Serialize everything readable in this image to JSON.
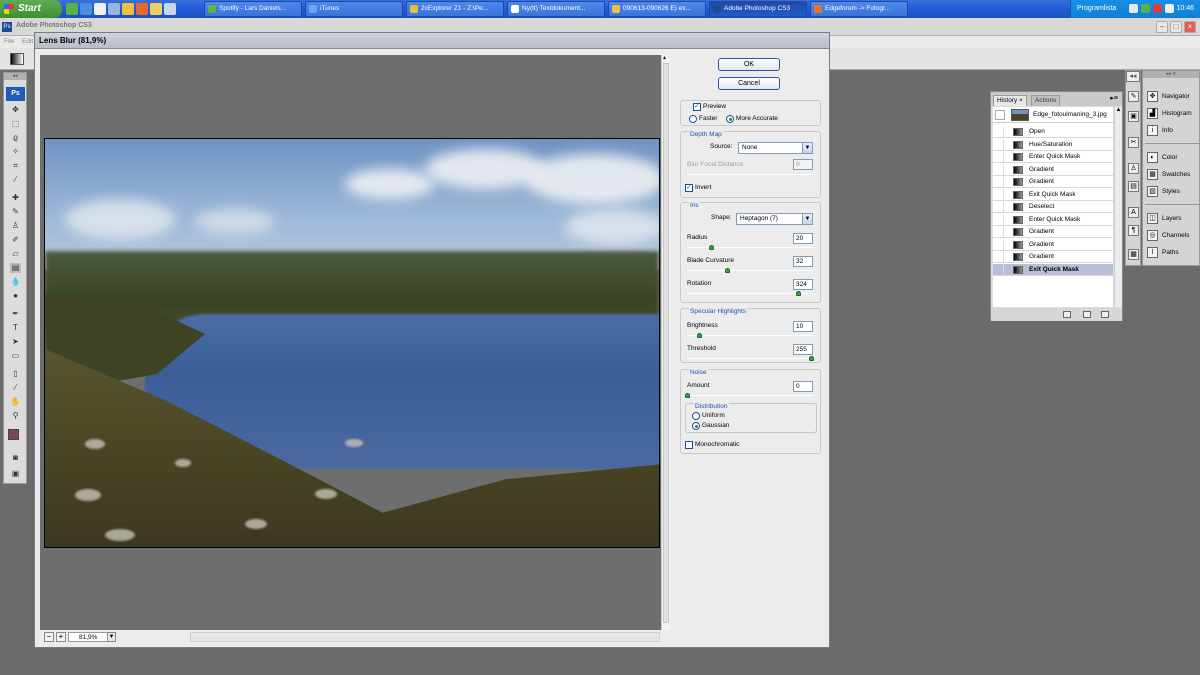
{
  "taskbar": {
    "start_label": "Start",
    "tasks": [
      {
        "label": "Spotify - Lars Daniels...",
        "color": "#5fb83c"
      },
      {
        "label": "iTunes",
        "color": "#6aa7e8"
      },
      {
        "label": "2xExplorer Z1 - Z:\\Pe...",
        "color": "#e0c040"
      },
      {
        "label": "Ny(tt) Textdokument...",
        "color": "#ffffff"
      },
      {
        "label": "090613-090626 E) ex...",
        "color": "#f0c040"
      },
      {
        "label": "Adobe Photoshop CS3",
        "color": "#1f4d93"
      },
      {
        "label": "Edgeforum -> Fotogr...",
        "color": "#e8732c"
      }
    ],
    "user": "Programlista",
    "clock": "10:46"
  },
  "photoshop": {
    "title": "Adobe Photoshop CS3",
    "logo": "Ps",
    "menu": [
      "File",
      "Edit"
    ]
  },
  "dialog": {
    "title": "Lens Blur (81,9%)",
    "ok_label": "OK",
    "cancel_label": "Cancel",
    "preview": {
      "label": "Preview",
      "checked": true
    },
    "faster_label": "Faster",
    "more_accurate_label": "More Accurate",
    "depth_map": {
      "group_label": "Depth Map",
      "source_label": "Source:",
      "source_value": "None",
      "blur_focal_label": "Blur Focal Distance",
      "blur_focal_value": "0",
      "invert_label": "Invert"
    },
    "iris": {
      "group_label": "Iris",
      "shape_label": "Shape:",
      "shape_value": "Heptagon (7)",
      "radius_label": "Radius",
      "radius_value": "20",
      "blade_label": "Blade Curvature",
      "blade_value": "32",
      "rotation_label": "Rotation",
      "rotation_value": "324"
    },
    "specular": {
      "group_label": "Specular Highlights",
      "brightness_label": "Brightness",
      "brightness_value": "10",
      "threshold_label": "Threshold",
      "threshold_value": "255"
    },
    "noise": {
      "group_label": "Noise",
      "amount_label": "Amount",
      "amount_value": "0",
      "distribution_label": "Distribution",
      "uniform_label": "Uniform",
      "gaussian_label": "Gaussian",
      "mono_label": "Monochromatic"
    },
    "zoom_value": "81,9%"
  },
  "history": {
    "tab_history": "History",
    "tab_actions": "Actions",
    "snapshot": "Edge_fotoulmaning_3.jpg",
    "steps": [
      "Open",
      "Hue/Saturation",
      "Enter Quick Mask",
      "Gradient",
      "Gradient",
      "Exit Quick Mask",
      "Deselect",
      "Enter Quick Mask",
      "Gradient",
      "Gradient",
      "Gradient",
      "Exit Quick Mask"
    ]
  },
  "dock": {
    "group1": [
      "Navigator",
      "Histogram",
      "Info"
    ],
    "group2": [
      "Color",
      "Swatches",
      "Styles"
    ],
    "group3": [
      "Layers",
      "Channels",
      "Paths"
    ]
  },
  "colors": {
    "foreground_swatch": "#7a4b4e",
    "background_swatch": "#ffffff"
  }
}
